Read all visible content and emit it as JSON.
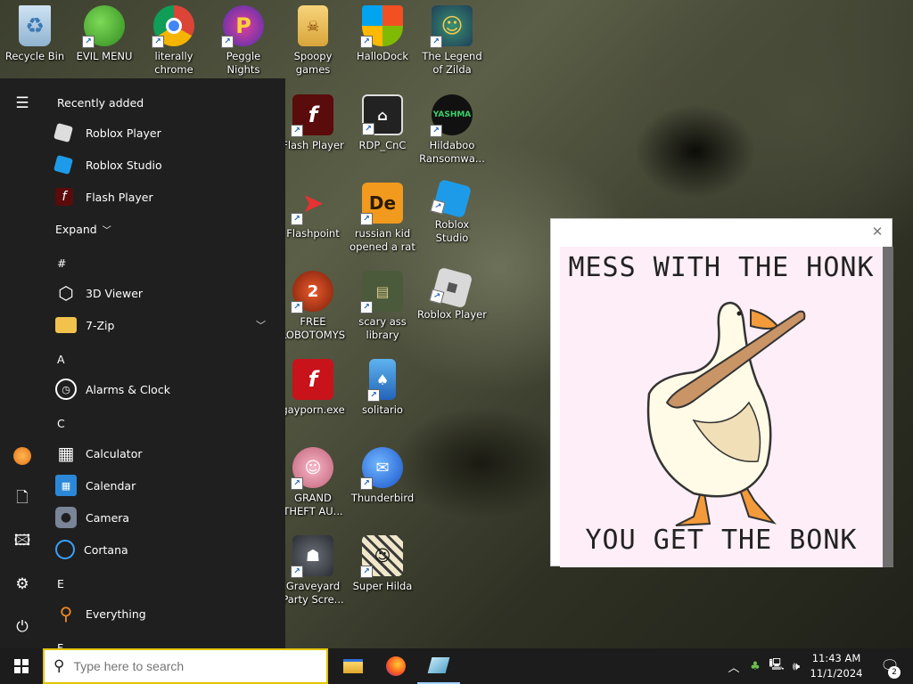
{
  "desktop": {
    "icons": [
      {
        "label": "Recycle Bin",
        "icon": "recycle-bin-icon"
      },
      {
        "label": "EVIL MENU",
        "icon": "msn-icon"
      },
      {
        "label": "literally chrome",
        "icon": "chrome-icon"
      },
      {
        "label": "Peggle Nights Deluxe",
        "icon": "peggle-icon"
      },
      {
        "label": "Spoopy games",
        "icon": "folder-icon"
      },
      {
        "label": "HalloDock",
        "icon": "windows-shield-icon"
      },
      {
        "label": "The Legend of Zilda",
        "icon": "zelda-icon"
      },
      {
        "label": "Flash Player",
        "icon": "flash-icon"
      },
      {
        "label": "RDP_CnC",
        "icon": "rdp-icon"
      },
      {
        "label": "Hildaboo Ransomwa...",
        "icon": "yashma-icon"
      },
      {
        "label": "Flashpoint",
        "icon": "flashpoint-icon"
      },
      {
        "label": "russian kid opened a rat",
        "icon": "de-icon"
      },
      {
        "label": "Roblox Studio",
        "icon": "roblox-studio-icon"
      },
      {
        "label": "FREE LOBOTOMYS",
        "icon": "lobotomy-icon"
      },
      {
        "label": "scary ass library",
        "icon": "library-icon"
      },
      {
        "label": "Roblox Player",
        "icon": "roblox-player-icon"
      },
      {
        "label": "gayporn.exe",
        "icon": "flash-exe-icon"
      },
      {
        "label": "solitario",
        "icon": "solitario-icon"
      },
      {
        "label": "GRAND THEFT AU...",
        "icon": "gta-icon"
      },
      {
        "label": "Thunderbird",
        "icon": "thunderbird-icon"
      },
      {
        "label": "Graveyard Party Scre...",
        "icon": "graveyard-icon"
      },
      {
        "label": "Super Hilda",
        "icon": "super-hilda-icon"
      }
    ]
  },
  "start_menu": {
    "recently_added": "Recently added",
    "recent_items": [
      {
        "label": "Roblox Player",
        "icon": "roblox-player-icon"
      },
      {
        "label": "Roblox Studio",
        "icon": "roblox-studio-icon"
      },
      {
        "label": "Flash Player",
        "icon": "flash-icon"
      }
    ],
    "expand": "Expand",
    "sections": [
      {
        "letter": "#",
        "items": [
          {
            "label": "3D Viewer"
          },
          {
            "label": "7-Zip"
          }
        ]
      },
      {
        "letter": "A",
        "items": [
          {
            "label": "Alarms & Clock"
          }
        ]
      },
      {
        "letter": "C",
        "items": [
          {
            "label": "Calculator"
          },
          {
            "label": "Calendar"
          },
          {
            "label": "Camera"
          },
          {
            "label": "Cortana"
          }
        ]
      },
      {
        "letter": "E",
        "items": [
          {
            "label": "Everything"
          }
        ]
      }
    ],
    "next_letter": "F"
  },
  "popup": {
    "top_text": "MESS WITH THE HONK",
    "bottom_text": "YOU GET THE BONK"
  },
  "taskbar": {
    "search_placeholder": "Type here to search",
    "time": "11:43 AM",
    "date": "11/1/2024",
    "notification_count": "2"
  }
}
